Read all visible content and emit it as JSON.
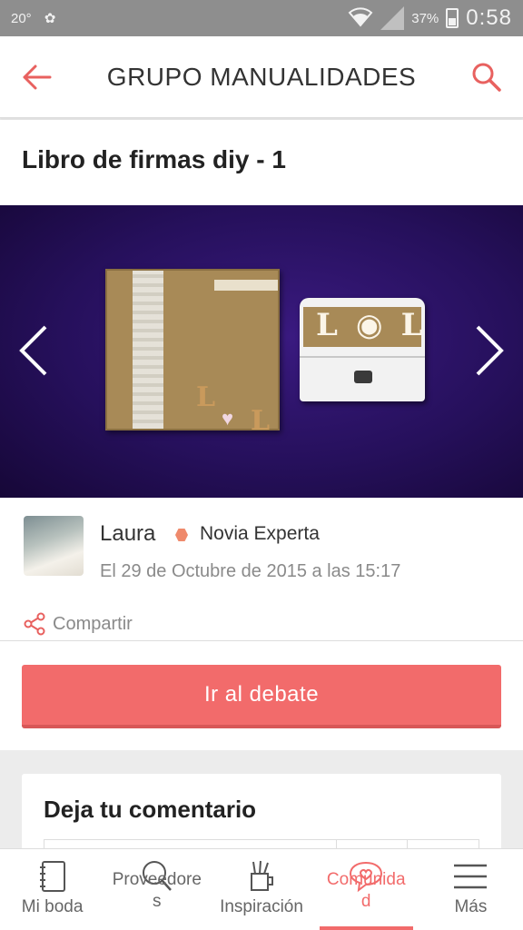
{
  "status_bar": {
    "temperature": "20°",
    "battery": "37%",
    "time": "0:58"
  },
  "header": {
    "title": "GRUPO MANUALIDADES",
    "back_icon": "back-arrow-icon",
    "search_icon": "search-icon"
  },
  "post": {
    "title": "Libro de firmas diy - 1"
  },
  "gallery": {
    "image_desc": "photo",
    "prev_icon": "chevron-left-icon",
    "next_icon": "chevron-right-icon"
  },
  "author": {
    "name": "Laura",
    "rank": "Novia Experta",
    "date": "El 29 de Octubre de 2015 a las 15:17"
  },
  "share": {
    "label": "Compartir"
  },
  "cta": {
    "label": "Ir al debate"
  },
  "comment": {
    "title": "Deja tu comentario"
  },
  "bottom_nav": {
    "items": [
      {
        "label": "Mi boda",
        "icon": "notebook-icon"
      },
      {
        "label": "Proveedore\ns",
        "icon": "search-icon"
      },
      {
        "label": "Inspiración",
        "icon": "pencil-cup-icon"
      },
      {
        "label": "Comunida\nd",
        "icon": "heart-chat-icon"
      },
      {
        "label": "Más",
        "icon": "menu-icon"
      }
    ]
  },
  "colors": {
    "accent": "#f26b6b",
    "status_bar": "#8e8e8e"
  }
}
